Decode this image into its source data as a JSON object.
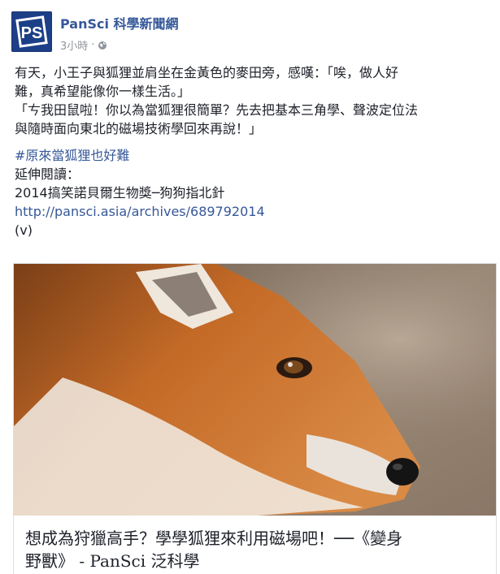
{
  "post": {
    "page_name": "PanSci 科學新聞網",
    "timestamp": "3小時",
    "separator": "·",
    "privacy_icon": "globe-icon",
    "logo_text": "PS",
    "text_line1": "有天，小王子與狐狸並肩坐在金黃色的麥田旁，感嘆：「唉，做人好",
    "text_line2": "難，真希望能像你一樣生活。」",
    "text_line3": "「ㄘ我田鼠啦！你以為當狐狸很簡單？先去把基本三角學、聲波定位法",
    "text_line4": "與隨時面向東北的磁場技術學回來再說！」",
    "hashtag": "#原來當狐狸也好難",
    "extended_label": "延伸閱讀：",
    "related_title": "2014搞笑諾貝爾生物獎─狗狗指北針",
    "related_url": "http://pansci.asia/archives/689792014",
    "signature": "(v)"
  },
  "card": {
    "image_subject": "red fox close-up photo",
    "caption_line1": "想成為狩獵高手？學學狐狸來利用磁場吧！──《變身",
    "caption_line2": "野獸》 - PanSci 泛科學"
  },
  "colors": {
    "link": "#365899",
    "text": "#1d2129",
    "muted": "#90949c",
    "logo_bg": "#1c3f87"
  }
}
